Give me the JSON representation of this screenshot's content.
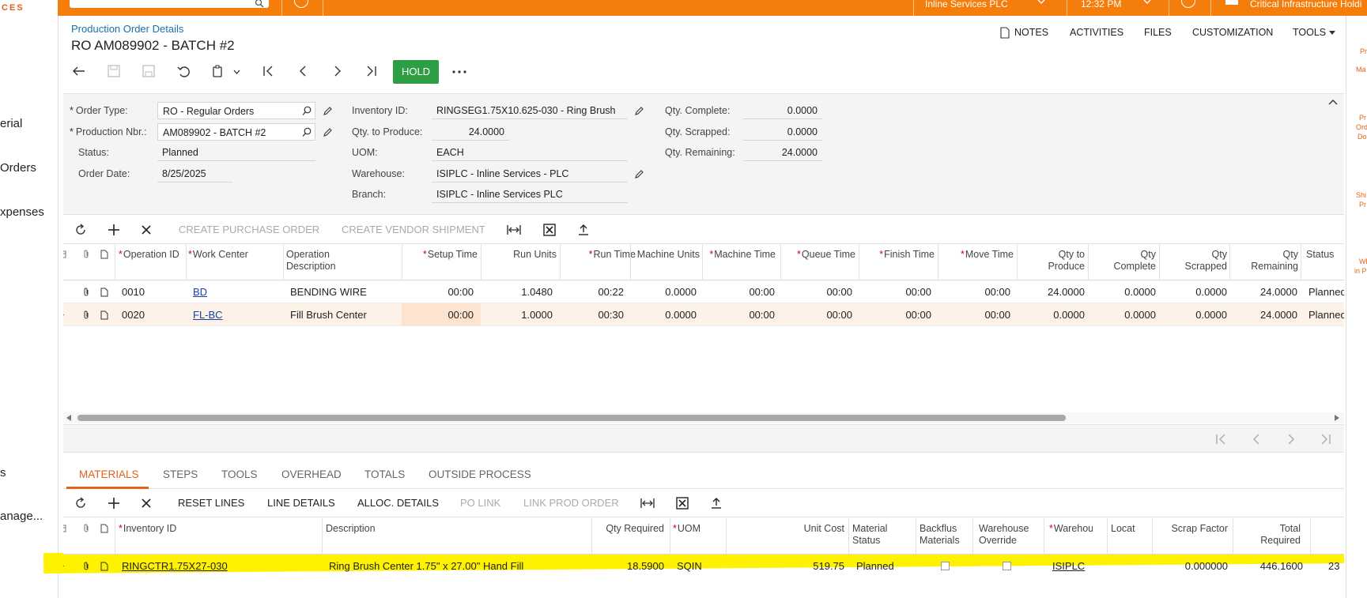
{
  "topbar": {
    "logo_text": "CES",
    "company": "Inline Services PLC",
    "time": "12:32 PM",
    "user": "Critical Infrastructure Holdi"
  },
  "leftnav": {
    "items": [
      "erial",
      "Orders",
      "xpenses",
      "s",
      "anage..."
    ]
  },
  "rightstrip": {
    "labels": [
      "Pr",
      "Ma",
      "Pr",
      "Ord",
      "Do",
      "Shi",
      "Pr",
      "Wh",
      "in P"
    ]
  },
  "header": {
    "breadcrumb": "Production Order Details",
    "title": "RO AM089902 - BATCH #2",
    "actions": [
      "NOTES",
      "ACTIVITIES",
      "FILES",
      "CUSTOMIZATION",
      "TOOLS"
    ],
    "hold_label": "HOLD"
  },
  "form": {
    "order_type_label": "Order Type:",
    "order_type": "RO - Regular Orders",
    "production_nbr_label": "Production Nbr.:",
    "production_nbr": "AM089902 - BATCH #2",
    "status_label": "Status:",
    "status": "Planned",
    "order_date_label": "Order Date:",
    "order_date": "8/25/2025",
    "inventory_id_label": "Inventory ID:",
    "inventory_id": "RINGSEG1.75X10.625-030 - Ring Brush",
    "qty_to_produce_label": "Qty. to Produce:",
    "qty_to_produce": "24.0000",
    "uom_label": "UOM:",
    "uom": "EACH",
    "warehouse_label": "Warehouse:",
    "warehouse": "ISIPLC - Inline Services - PLC",
    "branch_label": "Branch:",
    "branch": "ISIPLC - Inline Services PLC",
    "qty_complete_label": "Qty. Complete:",
    "qty_complete": "0.0000",
    "qty_scrapped_label": "Qty. Scrapped:",
    "qty_scrapped": "0.0000",
    "qty_remaining_label": "Qty. Remaining:",
    "qty_remaining": "24.0000"
  },
  "ops_toolbar": {
    "create_po": "CREATE PURCHASE ORDER",
    "create_vendor_shipment": "CREATE VENDOR SHIPMENT"
  },
  "ops_grid": {
    "headers": {
      "operation_id": "Operation ID",
      "work_center": "Work Center",
      "operation_description": "Operation Description",
      "setup_time": "Setup Time",
      "run_units": "Run Units",
      "run_time": "Run Time",
      "machine_units": "Machine Units",
      "machine_time": "Machine Time",
      "queue_time": "Queue Time",
      "finish_time": "Finish Time",
      "move_time": "Move Time",
      "qty_to_produce": "Qty to Produce",
      "qty_complete": "Qty Complete",
      "qty_scrapped": "Qty Scrapped",
      "qty_remaining": "Qty Remaining",
      "status": "Status"
    },
    "rows": [
      {
        "op": "0010",
        "wc": "BD",
        "desc": "BENDING WIRE",
        "setup": "00:00",
        "run_units": "1.0480",
        "run_time": "00:22",
        "machine_units": "0.0000",
        "machine_time": "00:00",
        "queue": "00:00",
        "finish": "00:00",
        "move": "00:00",
        "qty_prod": "24.0000",
        "qty_comp": "0.0000",
        "qty_scrap": "0.0000",
        "qty_rem": "24.0000",
        "status": "Planned"
      },
      {
        "op": "0020",
        "wc": "FL-BC",
        "desc": "Fill Brush Center",
        "setup": "00:00",
        "run_units": "1.0000",
        "run_time": "00:30",
        "machine_units": "0.0000",
        "machine_time": "00:00",
        "queue": "00:00",
        "finish": "00:00",
        "move": "00:00",
        "qty_prod": "0.0000",
        "qty_comp": "0.0000",
        "qty_scrap": "0.0000",
        "qty_rem": "24.0000",
        "status": "Planned"
      }
    ]
  },
  "tabs": [
    "MATERIALS",
    "STEPS",
    "TOOLS",
    "OVERHEAD",
    "TOTALS",
    "OUTSIDE PROCESS"
  ],
  "mat_toolbar": {
    "reset_lines": "RESET LINES",
    "line_details": "LINE DETAILS",
    "alloc_details": "ALLOC. DETAILS",
    "po_link": "PO LINK",
    "link_prod_order": "LINK PROD ORDER"
  },
  "mat_grid": {
    "headers": {
      "inventory_id": "Inventory ID",
      "description": "Description",
      "qty_required": "Qty Required",
      "uom": "UOM",
      "unit_cost": "Unit Cost",
      "material_status": "Material Status",
      "backflush": "Backflus Materials",
      "warehouse_override": "Warehouse Override",
      "warehouse": "Warehou",
      "location": "Locat",
      "scrap_factor": "Scrap Factor",
      "total_required": "Total Required"
    },
    "row": {
      "inventory_id": "RINGCTR1.75X27-030",
      "description": "Ring Brush Center 1.75\" x 27.00\" Hand Fill",
      "qty_required": "18.5900",
      "uom": "SQIN",
      "unit_cost": "519.75",
      "material_status": "Planned",
      "warehouse": "ISIPLC",
      "scrap_factor": "0.000000",
      "total_required": "446.1600",
      "extra": "23"
    }
  },
  "colors": {
    "brand_orange": "#f47d0b",
    "hold_green": "#2e9e44",
    "highlight_yellow": "#fff200",
    "link_blue": "#1a3ea8"
  }
}
